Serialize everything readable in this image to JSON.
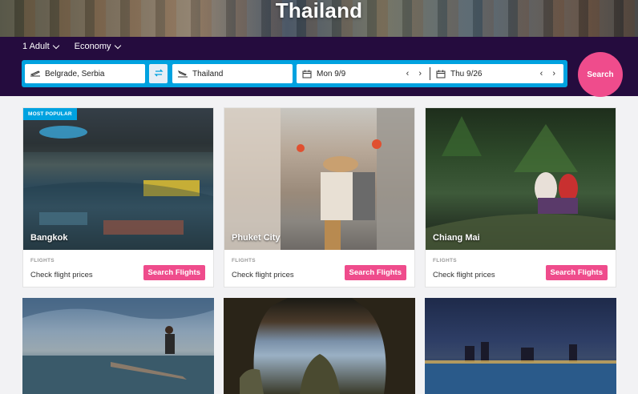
{
  "hero": {
    "title": "Thailand"
  },
  "options": {
    "passengers": "1 Adult",
    "cabin": "Economy"
  },
  "search": {
    "origin": "Belgrade, Serbia",
    "destination": "Thailand",
    "depart": "Mon 9/9",
    "return": "Thu 9/26",
    "button": "Search",
    "prev_arrow": "‹",
    "next_arrow": "›"
  },
  "cards": [
    {
      "city": "Bangkok",
      "badge": "MOST POPULAR",
      "section": "FLIGHTS",
      "caption": "Check flight prices",
      "button": "Search Flights"
    },
    {
      "city": "Phuket City",
      "section": "FLIGHTS",
      "caption": "Check flight prices",
      "button": "Search Flights"
    },
    {
      "city": "Chiang Mai",
      "section": "FLIGHTS",
      "caption": "Check flight prices",
      "button": "Search Flights"
    }
  ],
  "colors": {
    "band": "#250c3e",
    "accent": "#00a2e0",
    "pink": "#ef4c8c"
  },
  "icons": [
    "plane-takeoff-icon",
    "swap-icon",
    "plane-landing-icon",
    "calendar-icon",
    "chevron-down-icon"
  ]
}
